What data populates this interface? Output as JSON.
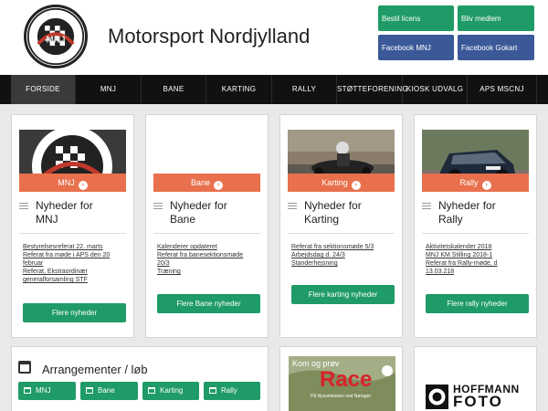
{
  "header": {
    "title": "Motorsport Nordjylland",
    "logo_text": "MOTORSPORT NORDJYLLAND",
    "logo_city": "AALBORG",
    "buttons": [
      "Bestil licens",
      "Bliv medlem",
      "Facebook MNJ",
      "Facebook Gokart"
    ]
  },
  "nav": {
    "items": [
      "FORSIDE",
      "MNJ",
      "BANE",
      "KARTING",
      "RALLY",
      "STØTTEFORENING",
      "KIOSK UDVALG",
      "APS MSCNJ"
    ]
  },
  "cards": [
    {
      "tag": "MNJ",
      "title_line1": "Nyheder for",
      "title_line2": "MNJ",
      "links": [
        "Bestyrelsesreferat 22. marts",
        "Referat fra møde i APS den 20",
        "februar",
        "Referat, Ekstraordinær",
        "generalforsamling STF"
      ],
      "button": "Flere nyheder"
    },
    {
      "tag": "Bane",
      "title_line1": "Nyheder for",
      "title_line2": "Bane",
      "links": [
        "Kalenderer opdateret",
        "Referat fra banesektionsmøde",
        "20/3",
        "Træning"
      ],
      "button": "Flere Bane nyheder"
    },
    {
      "tag": "Karting",
      "title_line1": "Nyheder for",
      "title_line2": "Karting",
      "links": [
        "Referat fra sektionsmøde 5/3",
        "Arbejdsdag d. 24/3",
        "Standerhejsning"
      ],
      "button": "Flere karting nyheder"
    },
    {
      "tag": "Rally",
      "title_line1": "Nyheder for",
      "title_line2": "Rally",
      "links": [
        "Aktivitetskalender 2018",
        "MNJ KM Stilling 2018-1",
        "Referat fra Rally-møde, d",
        "13.03.218"
      ],
      "button": "Flere rally nyheder"
    }
  ],
  "events": {
    "title": "Arrangementer / løb",
    "filters": [
      "MNJ",
      "Bane",
      "Karting",
      "Rally"
    ]
  },
  "promo": {
    "line1": "Kom og prøv",
    "line2": "Race",
    "line3": "På Nysumbanen ved Nørager"
  },
  "sponsor": {
    "name": "HOFFMANN",
    "sub": "FOTO"
  }
}
